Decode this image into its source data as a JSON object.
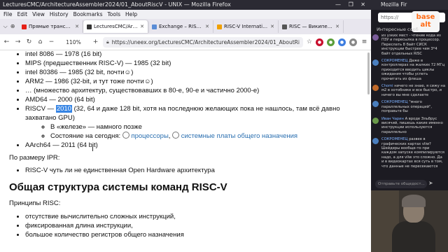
{
  "window": {
    "title": "LecturesCMC/ArchitectureAssembler2024/01_AboutRiscV - UNIX — Mozilla Firefox",
    "controls": "— ❐ ✕"
  },
  "menu": [
    "File",
    "Edit",
    "View",
    "History",
    "Bookmarks",
    "Tools",
    "Help"
  ],
  "tabs": [
    {
      "label": "Прямые трансляции",
      "color": "#e62117"
    },
    {
      "label": "LecturesCMC/Archi",
      "color": "#333333",
      "active": true
    },
    {
      "label": "Exchange – RISC-V In",
      "color": "#5b8dd6"
    },
    {
      "label": "RISC-V International",
      "color": "#f0a000"
    },
    {
      "label": "RISC — Википедия",
      "color": "#555555"
    }
  ],
  "navbar": {
    "zoom": "110%",
    "url": "https://uneex.org/LecturesCMC/ArchitectureAssembler2024/01_AboutRiscV"
  },
  "content": {
    "list": [
      "intel 8086 — 1978 (16 bit)",
      "MIPS (предшественник RISC-V) — 1985 (32 bit)",
      "intel 80386 — 1985 (32 bit, почти☺)",
      "ARM2 — 1986 (32-bit, и тут тоже почти☺)",
      "… (множество архитектур, существовавших в 80-е, 90-е и частично 2000-е)",
      "AMD64 — 2000 (64 bit)"
    ],
    "riscv_prefix": "RISCV — ",
    "riscv_year": "2010",
    "riscv_rest": " (32, 64 и даже 128 bit, хотя на последнюю желающих пока не нашлось, там всё давно захватано GPU)",
    "riscv_sub1": "В «железе» — намного позже",
    "riscv_sub2_prefix": "Состояние на сегодня: ",
    "riscv_sub2_link1": "процессоры",
    "riscv_sub2_sep": ", ",
    "riscv_sub2_link2": "системные платы общего назначения",
    "aarch": "AArch64 — 2011 (64 bit)",
    "ipr_label": "По размеру IPR:",
    "ipr_item": "RISC-V чуть ли не единственная Open Hardware архитектура",
    "heading": "Общая структура системы команд RISC-V",
    "principles_label": "Принципы RISC:",
    "principles": [
      "отсутствие вычислительно сложных инструкций,",
      "фиксированная длина инструкции,",
      "большое количество регистров общего назначения"
    ]
  },
  "side": {
    "title": "Mozilla Fir",
    "url": "https://",
    "logo_line1": "base",
    "logo_line2": "alt",
    "chat_header": "Интересные сооб",
    "messages": [
      {
        "name": "",
        "text": "из узких мест - чтение кода из ПЗУ и пересылка в процессор. Переслать 8 байт СИСК инструкции быстрее чем 3*4 байт отдельных RISC",
        "color": "#7a5c9a"
      },
      {
        "name": "СОКРОМЕНЕЦ",
        "text": "Даже в контроллерах на жалких 72 МГц приходится вводить циклы ожидания чтобы успеть прочитать из флеша",
        "color": "#4a7fbf"
      },
      {
        "name": "Chomi",
        "text": "ничего не знаю, я сижу на м2 в хотобнике и все быстро, и ничего вы мне сделаете",
        "color": "#c0692a"
      },
      {
        "name": "СОКРОМЕНЕЦ",
        "text": "\"много параллельных операций\", поправьте бы",
        "color": "#4a7fbf"
      },
      {
        "name": "Иван Чарин",
        "text": "А вроде Эльбрус висячий, пишешь какие именно инструкции используются параллельно",
        "color": "#6a9a4a"
      },
      {
        "name": "СОКРОМЕНЕЦ",
        "text": "развее в графических картах vliw? Шейдеры вообще-то при каждом запуске компилируются надо, а для vliw это сложно. Да и в видеокартах вся суть в том, что данные не пересекаются",
        "color": "#4a7fbf"
      }
    ],
    "chat_input": "Отправьте общедост..."
  }
}
